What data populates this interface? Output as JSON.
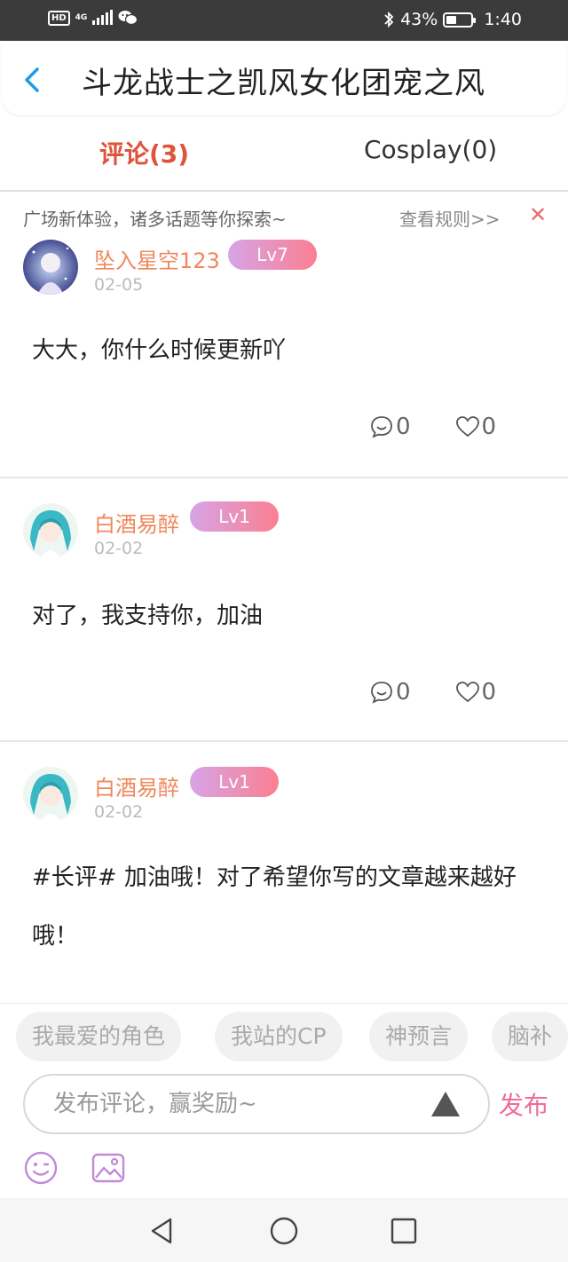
{
  "status_bar": {
    "network_badge": "HD",
    "network_type": "4G",
    "battery_percent": "43%",
    "battery_level": 0.43,
    "time": "1:40",
    "icons": [
      "hd-icon",
      "signal-icon",
      "wechat-icon",
      "bluetooth-icon",
      "battery-icon"
    ]
  },
  "header": {
    "title": "斗龙战士之凯风女化团宠之风",
    "back_icon": "chevron-left-icon"
  },
  "tabs": [
    {
      "label": "评论(3)",
      "active": true
    },
    {
      "label": "Cosplay(0)",
      "active": false
    }
  ],
  "notice": {
    "text": "广场新体验，诸多话题等你探索~",
    "rules_link": "查看规则>>",
    "close": "✕"
  },
  "comments": [
    {
      "username": "坠入星空123",
      "level": "Lv7",
      "date": "02-05",
      "text": "大大，你什么时候更新吖",
      "reply_count": "0",
      "like_count": "0"
    },
    {
      "username": "白酒易醉",
      "level": "Lv1",
      "date": "02-02",
      "text": "对了，我支持你，加油",
      "reply_count": "0",
      "like_count": "0"
    },
    {
      "username": "白酒易醉",
      "level": "Lv1",
      "date": "02-02",
      "text": "#长评# 加油哦！对了希望你写的文章越来越好哦！",
      "reply_count": "",
      "like_count": ""
    }
  ],
  "quick_tags": [
    "我最爱的角色",
    "我站的CP",
    "神预言",
    "脑补"
  ],
  "composer": {
    "placeholder": "发布评论，赢奖励~",
    "value": "",
    "publish_label": "发布"
  },
  "colors": {
    "accent_red": "#e0533b",
    "username_orange": "#f0885b",
    "publish_pink": "#ee6c9c",
    "level_gradient_start": "#d7a4e6",
    "level_gradient_end": "#fb7f92",
    "status_bar_bg": "#3b3b3b"
  }
}
